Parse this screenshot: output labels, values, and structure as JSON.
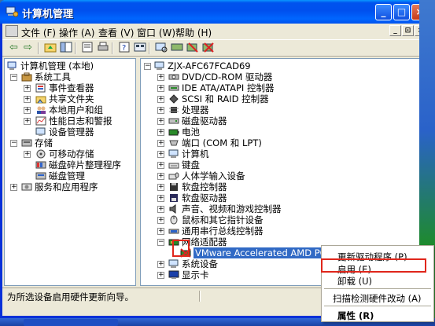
{
  "window": {
    "title": "计算机管理",
    "controls": [
      "_",
      "□",
      "×"
    ]
  },
  "menubar": {
    "items": [
      "文件 (F)",
      "操作 (A)",
      "查看 (V)",
      "窗口 (W)",
      "帮助 (H)"
    ],
    "mdi_controls": [
      "_",
      "⊡",
      "×"
    ]
  },
  "toolbar": {
    "buttons": [
      "back-icon",
      "forward-icon",
      "up-icon",
      "show-tree-icon",
      "properties-icon",
      "print-icon",
      "help-icon",
      "view-icon",
      "scan-icon",
      "update-icon",
      "disable-icon",
      "uninstall-icon"
    ]
  },
  "left_tree": {
    "items": [
      {
        "label": "计算机管理 (本地)"
      },
      {
        "label": "系统工具"
      },
      {
        "label": "事件查看器"
      },
      {
        "label": "共享文件夹"
      },
      {
        "label": "本地用户和组"
      },
      {
        "label": "性能日志和警报"
      },
      {
        "label": "设备管理器"
      },
      {
        "label": "存储"
      },
      {
        "label": "可移动存储"
      },
      {
        "label": "磁盘碎片整理程序"
      },
      {
        "label": "磁盘管理"
      },
      {
        "label": "服务和应用程序"
      }
    ]
  },
  "device_tree": {
    "root": "ZJX-AFC67FCAD69",
    "items": [
      {
        "label": "DVD/CD-ROM 驱动器"
      },
      {
        "label": "IDE ATA/ATAPI 控制器"
      },
      {
        "label": "SCSI 和 RAID 控制器"
      },
      {
        "label": "处理器"
      },
      {
        "label": "磁盘驱动器"
      },
      {
        "label": "电池"
      },
      {
        "label": "端口 (COM 和 LPT)"
      },
      {
        "label": "计算机"
      },
      {
        "label": "键盘"
      },
      {
        "label": "人体学输入设备"
      },
      {
        "label": "软盘控制器"
      },
      {
        "label": "软盘驱动器"
      },
      {
        "label": "声音、视频和游戏控制器"
      },
      {
        "label": "鼠标和其它指针设备"
      },
      {
        "label": "通用串行总线控制器"
      },
      {
        "label": "网络适配器"
      },
      {
        "label": "VMware Accelerated AMD PCNet Adapter"
      },
      {
        "label": "系统设备"
      },
      {
        "label": "显示卡"
      }
    ]
  },
  "context_menu": {
    "items": [
      "更新驱动程序 (P)...",
      "启用 (E)",
      "卸载 (U)",
      "扫描检测硬件改动 (A)",
      "属性 (R)"
    ]
  },
  "statusbar": {
    "text": "为所选设备启用硬件更新向导。"
  },
  "colors": {
    "title_blue": "#0053ee",
    "selection": "#316ac5",
    "highlight_red": "#e0261b"
  }
}
